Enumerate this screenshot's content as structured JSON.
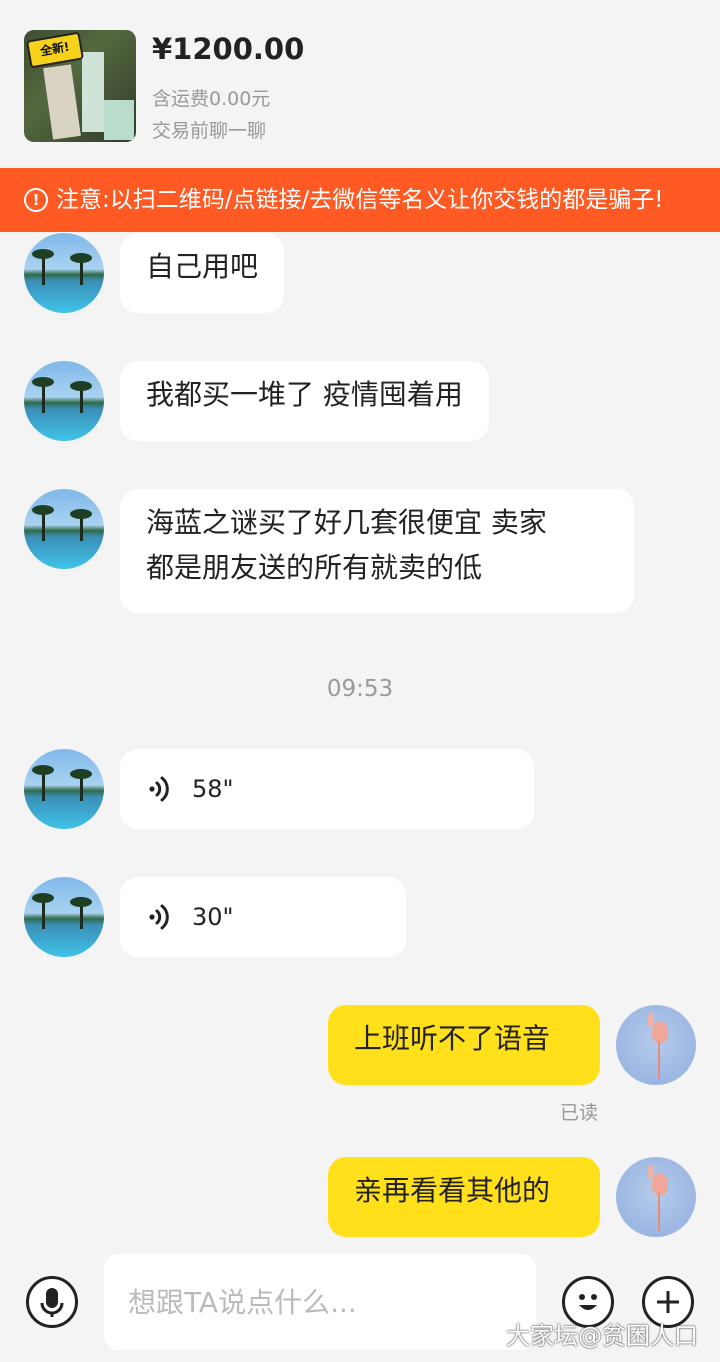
{
  "product": {
    "badge": "全新!",
    "price": "¥1200.00",
    "shipping": "含运费0.00元",
    "chat_hint": "交易前聊一聊"
  },
  "warning": {
    "icon": "exclamation-circle-icon",
    "text": "注意:以扫二维码/点链接/去微信等名义让你交钱的都是骗子!"
  },
  "messages": [
    {
      "side": "left",
      "type": "text",
      "text": "自己用吧"
    },
    {
      "side": "left",
      "type": "text",
      "text": "我都买一堆了 疫情囤着用"
    },
    {
      "side": "left",
      "type": "text",
      "line1": "海蓝之谜买了好几套很便宜 卖家",
      "line2": "都是朋友送的所有就卖的低"
    },
    {
      "side": "left",
      "type": "voice",
      "duration": "58\""
    },
    {
      "side": "left",
      "type": "voice",
      "duration": "30\""
    },
    {
      "side": "right",
      "type": "text",
      "text": "上班听不了语音"
    },
    {
      "side": "right",
      "type": "text",
      "text": "亲再看看其他的"
    }
  ],
  "timestamp": "09:53",
  "read_receipt": "已读",
  "input": {
    "placeholder": "想跟TA说点什么...",
    "voice_icon": "microphone-icon",
    "emoji_icon": "emoji-smile-icon",
    "more_icon": "plus-icon"
  },
  "watermark": "大家坛@贫困人口",
  "colors": {
    "accent_yellow": "#ffe01b",
    "warning_orange": "#ff5a23",
    "background": "#f4f4f4"
  }
}
